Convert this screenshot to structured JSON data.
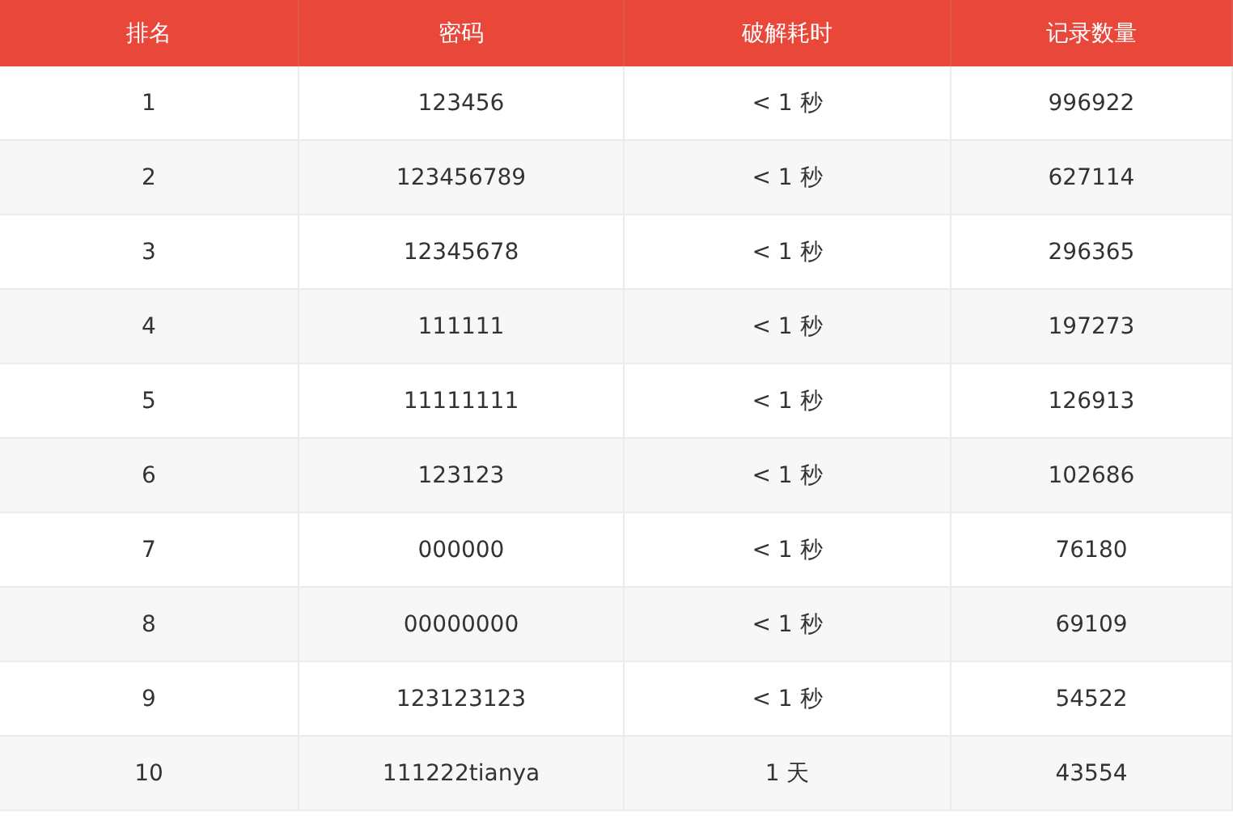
{
  "table": {
    "columns": [
      "排名",
      "密码",
      "破解耗时",
      "记录数量"
    ],
    "rows": [
      [
        "1",
        "123456",
        "< 1 秒",
        "996922"
      ],
      [
        "2",
        "123456789",
        "< 1 秒",
        "627114"
      ],
      [
        "3",
        "12345678",
        "< 1 秒",
        "296365"
      ],
      [
        "4",
        "111111",
        "< 1 秒",
        "197273"
      ],
      [
        "5",
        "11111111",
        "< 1 秒",
        "126913"
      ],
      [
        "6",
        "123123",
        "< 1 秒",
        "102686"
      ],
      [
        "7",
        "000000",
        "< 1 秒",
        "76180"
      ],
      [
        "8",
        "00000000",
        "< 1 秒",
        "69109"
      ],
      [
        "9",
        "123123123",
        "< 1 秒",
        "54522"
      ],
      [
        "10",
        "111222tianya",
        "1 天",
        "43554"
      ]
    ]
  }
}
